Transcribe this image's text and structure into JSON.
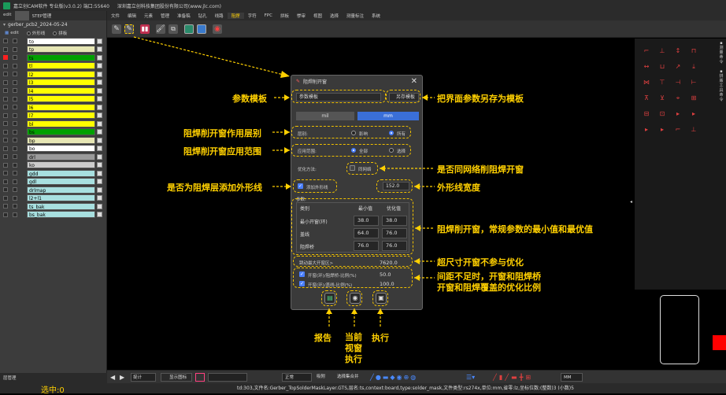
{
  "titlebar": {
    "app": "嘉立创CAM软件 专业版(v3.0.2) 端口:55640",
    "company": "深圳嘉立创科技集团股份有限公司(www.jlc.com)"
  },
  "left_panel": {
    "tabs": [
      "edit",
      "STEP管理"
    ],
    "file": "gerber_pcb2_2024-05-24",
    "opts": [
      "edit",
      "外形线",
      "拼板"
    ],
    "layers": [
      {
        "name": "to",
        "color": "#ffffff"
      },
      {
        "name": "tp",
        "color": "#e6e6b4"
      },
      {
        "name": "ts",
        "color": "#00a000"
      },
      {
        "name": "tl",
        "color": "#ffff00"
      },
      {
        "name": "l2",
        "color": "#ffff00"
      },
      {
        "name": "l3",
        "color": "#ffff00"
      },
      {
        "name": "l4",
        "color": "#ffff00"
      },
      {
        "name": "l5",
        "color": "#ffff00"
      },
      {
        "name": "l6",
        "color": "#ffff00"
      },
      {
        "name": "l7",
        "color": "#ffff00"
      },
      {
        "name": "bl",
        "color": "#ffff00"
      },
      {
        "name": "bs",
        "color": "#00a000"
      },
      {
        "name": "bp",
        "color": "#e6e6b4"
      },
      {
        "name": "bo",
        "color": "#ffffff"
      },
      {
        "name": "drl",
        "color": "#9a9a9a"
      },
      {
        "name": "ko",
        "color": "#cccccc"
      },
      {
        "name": "gdd",
        "color": "#a8e0e0"
      },
      {
        "name": "gdl",
        "color": "#a8e0e0"
      },
      {
        "name": "drlmap",
        "color": "#a8e0e0"
      },
      {
        "name": "l2+l1",
        "color": "#a8e0e0"
      },
      {
        "name": "ts_bak",
        "color": "#a8e0e0"
      },
      {
        "name": "bs_bak",
        "color": "#a8e0e0"
      }
    ],
    "bottom_tab": "层管理",
    "selected": "选中:0"
  },
  "menubar": [
    "文件",
    "编辑",
    "元素",
    "管理",
    "准备稿",
    "钻孔",
    "线路",
    "阻焊",
    "字符",
    "FPC",
    "拼板",
    "惨审",
    "视图",
    "选择",
    "测量标注",
    "系统"
  ],
  "menu_active": "阻焊",
  "dialog": {
    "title": "阻焊削开窗",
    "template_placeholder": "参数模板",
    "save_template": "另存模板",
    "unit_mil": "mil",
    "unit_mm": "mm",
    "layer_label": "层别:",
    "layer_opts": [
      "影响",
      "所有"
    ],
    "range_label": "应用范围:",
    "range_opts": [
      "全部",
      "选择"
    ],
    "optimize_label": "优化方法:",
    "same_net": "同网络",
    "add_outline": "添加外形线",
    "outline_width": "152.0",
    "params_label": "参数:",
    "table_headers": [
      "类别",
      "最小值",
      "优化值"
    ],
    "table_rows": [
      {
        "name": "最小开窗(环)",
        "min": "38.0",
        "opt": "38.0"
      },
      {
        "name": "盖线",
        "min": "64.0",
        "opt": "76.0"
      },
      {
        "name": "阻焊桥",
        "min": "76.0",
        "opt": "76.0"
      }
    ],
    "oversize_label": "跳动最大开窗区>",
    "oversize_value": "7620.0",
    "ratio1_label": "开窗(环)/阻焊桥-比例(%)",
    "ratio1_value": "50.0",
    "ratio2_label": "开窗(环)/盖线-比例(%)",
    "ratio2_value": "100.0"
  },
  "annotations": {
    "param_template": "参数模板",
    "save_as_template": "把界面参数另存为模板",
    "layer_effect": "阻焊削开窗作用层别",
    "apply_range": "阻焊削开窗应用范围",
    "same_net": "是否同网络削阻焊开窗",
    "add_outline": "是否为阻焊层添加外形线",
    "outline_width": "外形线宽度",
    "min_opt": "阻焊削开窗，常规参数的最小值和最优值",
    "oversize": "超尺寸开窗不参与优化",
    "ratio_line1": "间距不足时，开窗和阻焊桥",
    "ratio_line2": "开窗和阻焊覆盖的优化比例",
    "report": "报告",
    "current_view_1": "当前",
    "current_view_2": "视窗",
    "current_view_3": "执行",
    "execute": "执行"
  },
  "bottombar": {
    "mode": "捉计",
    "show_name": "显示图标",
    "normal": "正常",
    "snap": "吸附",
    "select_mode": "选择集合并",
    "unit": "MM"
  },
  "status": "td:303,文件名:Gerber_TopSolderMaskLayer.GTS,层名:ts,context:board,type:solder_mask,文件类型:rs274x,单位:mm,省零:lz,坐标位数:(整数)3 (小数)5",
  "preview_colors": {
    "outline": "#dddddd",
    "marker": "#ff0000"
  },
  "accent": "#ffd000"
}
